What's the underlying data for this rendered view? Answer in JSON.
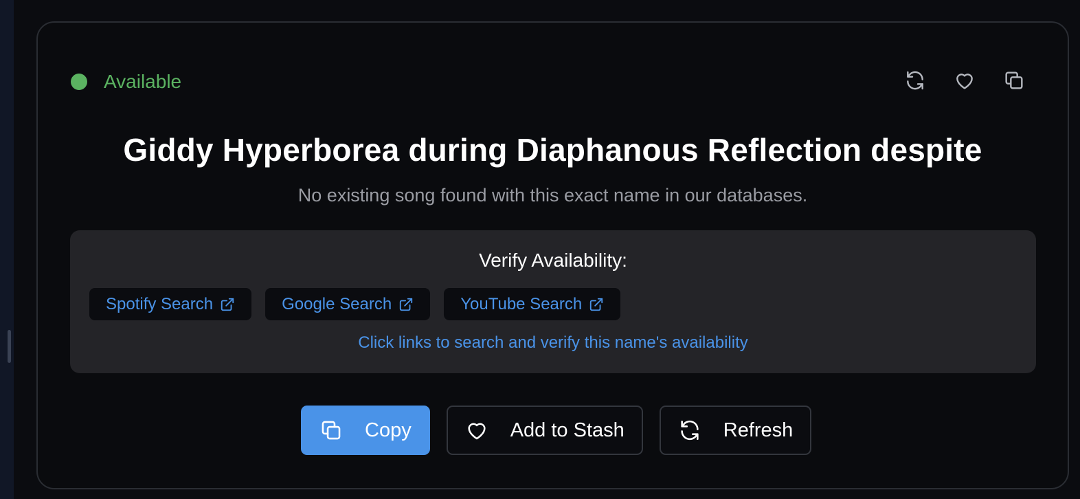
{
  "status": {
    "label": "Available",
    "color": "#5bb361"
  },
  "top_actions": [
    {
      "icon": "refresh-icon"
    },
    {
      "icon": "heart-icon"
    },
    {
      "icon": "copy-icon"
    }
  ],
  "title": "Giddy Hyperborea during Diaphanous Reflection despite",
  "subtitle": "No existing song found with this exact name in our databases.",
  "verify": {
    "heading": "Verify Availability:",
    "links": [
      {
        "label": "Spotify Search",
        "icon": "external-link-icon"
      },
      {
        "label": "Google Search",
        "icon": "external-link-icon"
      },
      {
        "label": "YouTube Search",
        "icon": "external-link-icon"
      }
    ],
    "hint": "Click links to search and verify this name's availability"
  },
  "actions": {
    "copy": {
      "label": "Copy",
      "icon": "copy-icon"
    },
    "stash": {
      "label": "Add to Stash",
      "icon": "heart-icon"
    },
    "refresh": {
      "label": "Refresh",
      "icon": "refresh-icon"
    }
  },
  "colors": {
    "accent": "#4a93e8",
    "available": "#5bb361",
    "background": "#0a0b0e",
    "panel": "#242428"
  }
}
